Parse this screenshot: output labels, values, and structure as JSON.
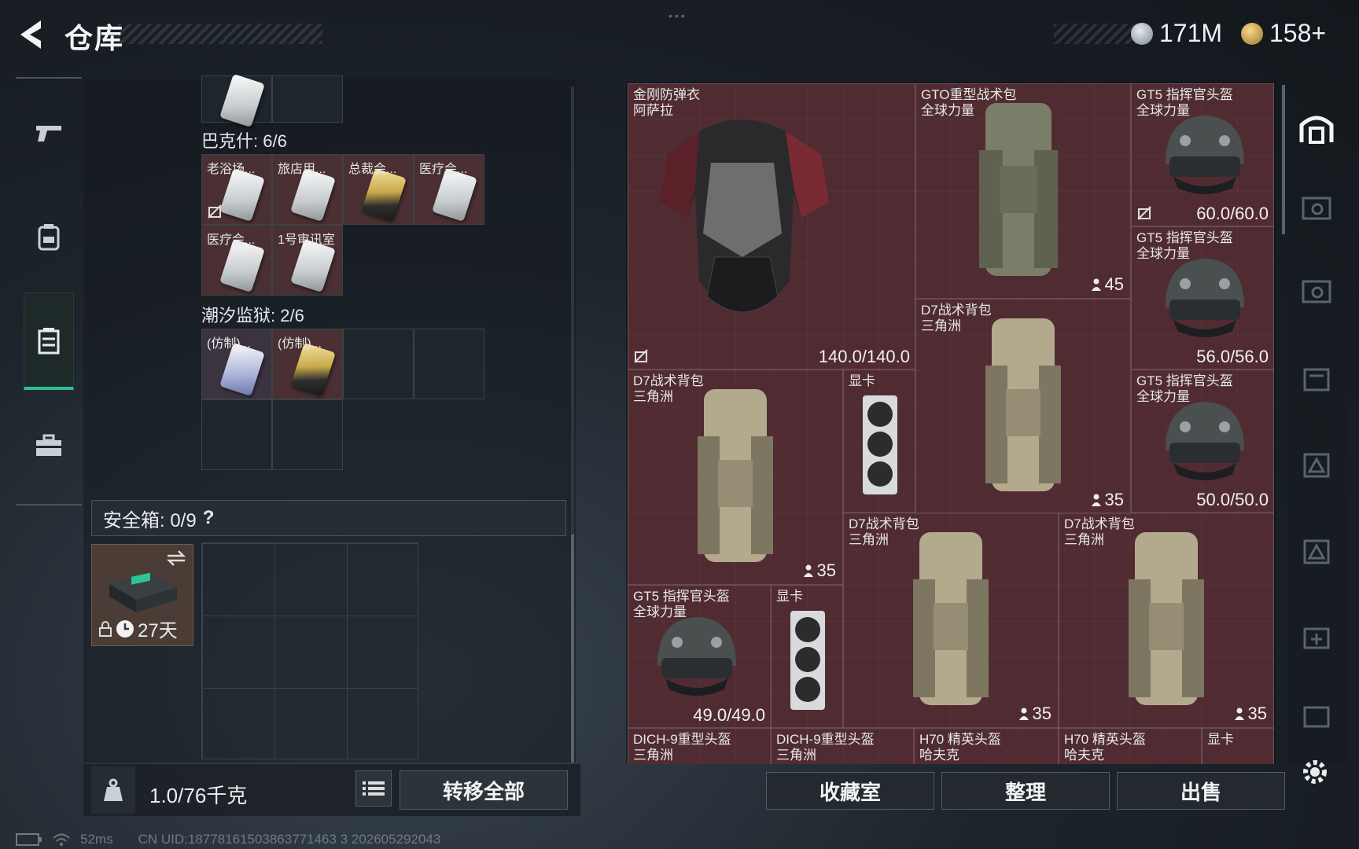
{
  "header": {
    "title": "仓库",
    "currency_silver": "171M",
    "currency_gold": "158+"
  },
  "left_nav": {
    "items": [
      {
        "name": "weapons",
        "icon": "pistol-icon"
      },
      {
        "name": "equipment",
        "icon": "backpack-icon"
      },
      {
        "name": "containers",
        "icon": "crate-icon",
        "active": true
      },
      {
        "name": "toolbox",
        "icon": "toolbox-icon"
      }
    ]
  },
  "stash": {
    "group1": {
      "label": "巴克什: 6/6",
      "cards": [
        "老浴场...",
        "旅店用...",
        "总裁会...",
        "医疗会...",
        "医疗会...",
        "1号审讯室"
      ]
    },
    "group2": {
      "label": "潮汐监狱: 2/6",
      "cards": [
        "(仿制)...",
        "(仿制)..."
      ]
    },
    "safebox_label": "安全箱: 0/9",
    "safebox_help": "?",
    "safebox_time": "27天",
    "weight": "1.0/76千克",
    "transfer_all": "转移全部"
  },
  "inventory": {
    "items": [
      {
        "name1": "金刚防弹衣",
        "name2": "阿萨拉",
        "value": "140.0/140.0"
      },
      {
        "name1": "GTO重型战术包",
        "name2": "全球力量",
        "count": "45"
      },
      {
        "name1": "GT5 指挥官头盔",
        "name2": "全球力量",
        "value": "60.0/60.0"
      },
      {
        "name1": "GT5 指挥官头盔",
        "name2": "全球力量",
        "value": "56.0/56.0"
      },
      {
        "name1": "D7战术背包",
        "name2": "三角洲",
        "count": "35"
      },
      {
        "name1": "GT5 指挥官头盔",
        "name2": "全球力量",
        "value": "50.0/50.0"
      },
      {
        "name1": "D7战术背包",
        "name2": "三角洲",
        "count": "35"
      },
      {
        "name1": "显卡",
        "name2": ""
      },
      {
        "name1": "D7战术背包",
        "name2": "三角洲",
        "count": "35"
      },
      {
        "name1": "D7战术背包",
        "name2": "三角洲",
        "count": "35"
      },
      {
        "name1": "GT5 指挥官头盔",
        "name2": "全球力量",
        "value": "49.0/49.0"
      },
      {
        "name1": "显卡",
        "name2": ""
      },
      {
        "name1": "DICH-9重型头盔",
        "name2": "三角洲"
      },
      {
        "name1": "DICH-9重型头盔",
        "name2": "三角洲"
      },
      {
        "name1": "H70 精英头盔",
        "name2": "哈夫克"
      },
      {
        "name1": "H70 精英头盔",
        "name2": "哈夫克"
      },
      {
        "name1": "显卡",
        "name2": ""
      }
    ],
    "buttons": {
      "collection": "收藏室",
      "sort": "整理",
      "sell": "出售"
    }
  },
  "status_bar": {
    "ping": "52ms",
    "uid": "CN UID:18778161503863771463 3 202605292043"
  },
  "colors": {
    "accent_green": "#2fbf8f",
    "item_red": "#4a2b30"
  }
}
